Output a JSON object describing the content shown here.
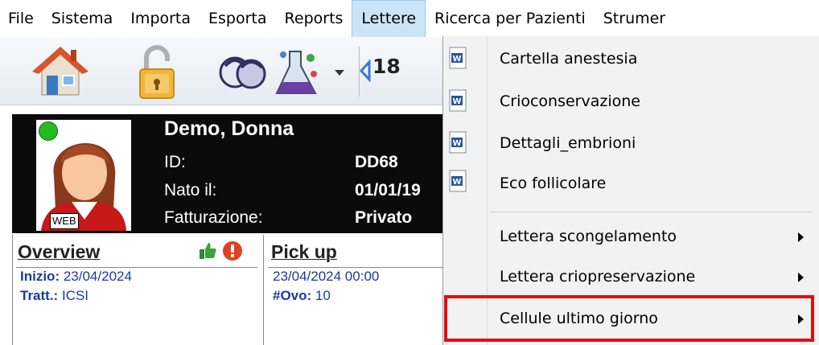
{
  "menubar": {
    "items": [
      "File",
      "Sistema",
      "Importa",
      "Esporta",
      "Reports",
      "Lettere",
      "Ricerca per Pazienti",
      "Strumer"
    ],
    "active": "Lettere"
  },
  "toolbar": {
    "icons": [
      "home-icon",
      "padlock-icon",
      "patients-icon",
      "lab-flask-icon",
      "dropdown-arrow-icon",
      "back-arrow-icon"
    ],
    "date_fragment": "18"
  },
  "patient": {
    "name": "Demo, Donna",
    "id_label": "ID:",
    "id_value": "DD68",
    "dob_label": "Nato il:",
    "dob_value": "01/01/19",
    "billing_label": "Fatturazione:",
    "billing_value": "Privato",
    "web_badge": "WEB",
    "status_color": "#22bb22"
  },
  "overview": {
    "title": "Overview",
    "start_label": "Inizio:",
    "start_value": "23/04/2024",
    "treatment_label": "Tratt.:",
    "treatment_value": "ICSI"
  },
  "pickup": {
    "title": "Pick up",
    "datetime": "23/04/2024 00:00",
    "ovo_label": "#Ovo:",
    "ovo_value": "10"
  },
  "dropdown": {
    "items": [
      {
        "label": "Cartella anestesia",
        "icon": "word-doc-icon",
        "submenu": false
      },
      {
        "label": "Crioconservazione",
        "icon": "word-doc-icon",
        "submenu": false
      },
      {
        "label": "Dettagli_embrioni",
        "icon": "word-doc-icon",
        "submenu": false
      },
      {
        "label": "Eco follicolare",
        "icon": "word-doc-icon",
        "submenu": false
      },
      {
        "label": "Lettera scongelamento",
        "icon": "",
        "submenu": true
      },
      {
        "label": "Lettera criopreservazione",
        "icon": "",
        "submenu": true
      },
      {
        "label": "Cellule ultimo giorno",
        "icon": "",
        "submenu": true,
        "highlighted": true
      }
    ],
    "highlight_color": "#e01010"
  }
}
